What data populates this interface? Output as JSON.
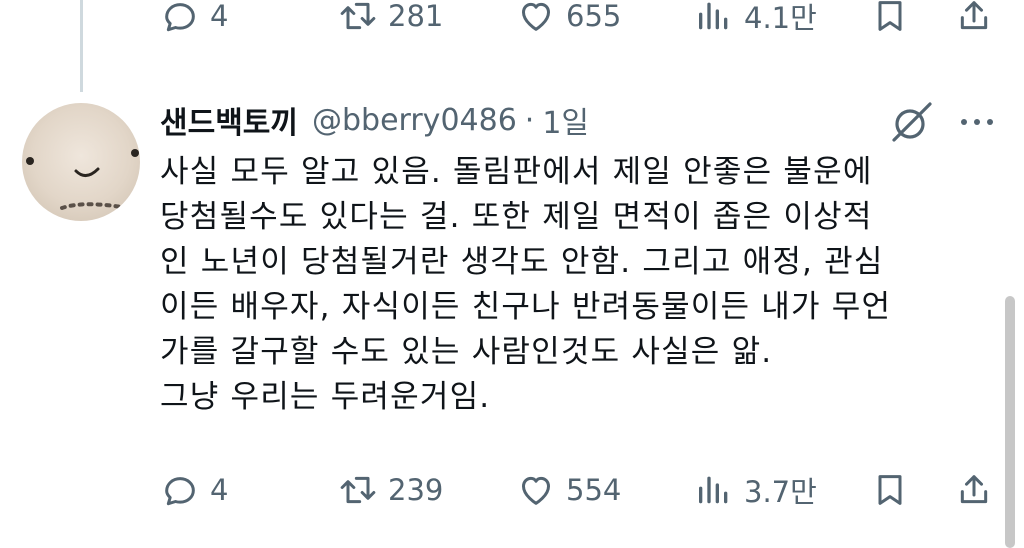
{
  "top_actions": {
    "reply_count": "4",
    "repost_count": "281",
    "like_count": "655",
    "views_count": "4.1만"
  },
  "tweet": {
    "display_name": "샌드백토끼",
    "handle": "@bberry0486",
    "separator": "·",
    "time_ago": "1일",
    "text_lines": [
      "사실 모두 알고 있음. 돌림판에서 제일 안좋은 불운에",
      "당첨될수도 있다는 걸. 또한 제일 면적이 좁은 이상적",
      "인 노년이 당첨될거란 생각도 안함. 그리고 애정, 관심",
      "이든 배우자, 자식이든 친구나 반려동물이든 내가 무언",
      "가를 갈구할 수도 있는 사람인것도 사실은 앎.",
      "그냥 우리는 두려운거임."
    ],
    "actions": {
      "reply_count": "4",
      "repost_count": "239",
      "like_count": "554",
      "views_count": "3.7만"
    }
  },
  "icons": [
    "reply-icon",
    "repost-icon",
    "like-icon",
    "views-icon",
    "bookmark-icon",
    "share-icon",
    "grok-icon",
    "more-icon"
  ],
  "colors": {
    "text": "#0f1419",
    "secondary": "#536471",
    "thread_line": "#cfd9de"
  }
}
